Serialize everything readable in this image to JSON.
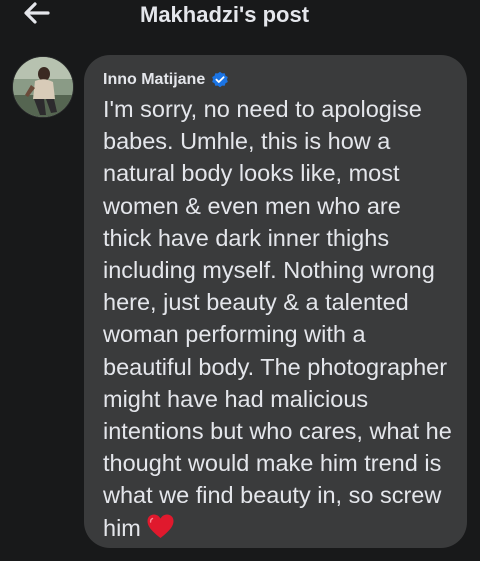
{
  "header": {
    "back_icon": "arrow-left-icon",
    "title": "Makhadzi's post"
  },
  "comment": {
    "avatar_icon": "user-avatar",
    "author": "Inno Matijane",
    "verified_icon": "verified-badge-icon",
    "text": "I'm sorry, no need to apologise babes. Umhle, this is how a natural body looks like, most women & even men who are thick have dark inner thighs including myself. Nothing wrong here, just beauty & a talented woman performing with a beautiful body. The photographer might have had malicious intentions but who cares, what he thought would make him trend is what we find beauty in, so screw him",
    "emoji_icon": "red-heart-icon"
  },
  "colors": {
    "background": "#18191a",
    "bubble": "#3a3b3c",
    "text": "#e4e6eb",
    "verified": "#1b74e4",
    "heart": "#e0192d"
  }
}
